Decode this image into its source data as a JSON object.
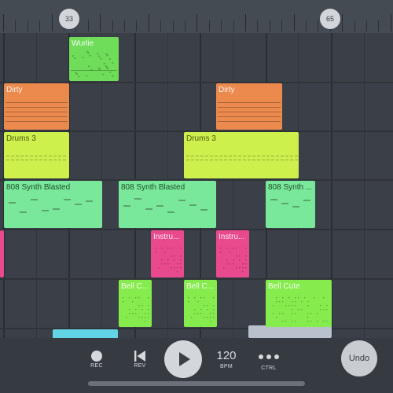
{
  "timeline": {
    "markers": [
      {
        "label": "33"
      },
      {
        "label": "65"
      }
    ]
  },
  "clips": [
    {
      "id": "wurlie",
      "name": "Wurlie",
      "color": "#6fdc5a",
      "label_color": "#f4fbf2"
    },
    {
      "id": "dirty-1",
      "name": "Dirty",
      "color": "#ec8a4e",
      "label_color": "#fff1e6"
    },
    {
      "id": "dirty-2",
      "name": "Dirty",
      "color": "#ec8a4e",
      "label_color": "#fff1e6"
    },
    {
      "id": "drums-3-1",
      "name": "Drums 3",
      "color": "#cdf04d",
      "label_color": "#4d5a12"
    },
    {
      "id": "drums-3-2",
      "name": "Drums 3",
      "color": "#cdf04d",
      "label_color": "#4d5a12"
    },
    {
      "id": "synth-1",
      "name": "808 Synth Blasted",
      "color": "#7ae89a",
      "label_color": "#1f4d2c"
    },
    {
      "id": "synth-2",
      "name": "808 Synth Blasted",
      "color": "#7ae89a",
      "label_color": "#1f4d2c"
    },
    {
      "id": "synth-3",
      "name": "808 Synth ...",
      "color": "#7ae89a",
      "label_color": "#1f4d2c"
    },
    {
      "id": "instru-1",
      "name": "Instru...",
      "color": "#e84a8d",
      "label_color": "#fde8f1"
    },
    {
      "id": "instru-2",
      "name": "Instru...",
      "color": "#e84a8d",
      "label_color": "#fde8f1"
    },
    {
      "id": "bell-1",
      "name": "Bell C...",
      "color": "#86ec4e",
      "label_color": "#f5fff0"
    },
    {
      "id": "bell-2",
      "name": "Bell C...",
      "color": "#86ec4e",
      "label_color": "#f5fff0"
    },
    {
      "id": "bell-3",
      "name": "Bell Cute",
      "color": "#86ec4e",
      "label_color": "#f5fff0"
    }
  ],
  "toolbar": {
    "rec_label": "REC",
    "rev_label": "REV",
    "bpm_value": "120",
    "bpm_label": "BPM",
    "ctrl_label": "CTRL",
    "undo_label": "Undo",
    "icons": {
      "rec": "record-dot-icon",
      "rev": "skip-back-icon",
      "play": "play-icon",
      "ctrl": "more-dots-icon"
    }
  },
  "colors": {
    "background": "#3b4048",
    "ruler": "#454b53",
    "toolbar": "#363a41"
  }
}
